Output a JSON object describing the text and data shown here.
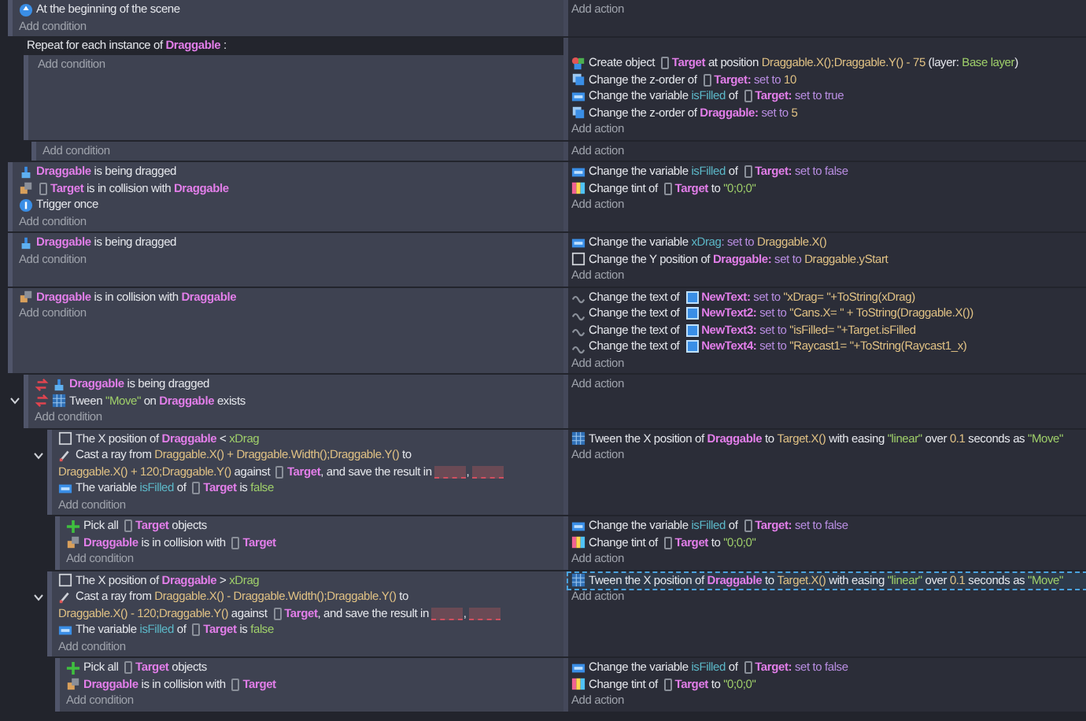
{
  "events": [
    {
      "conditions": [
        {
          "kind": "start",
          "inverted": false,
          "parts": [
            {
              "kind": "text",
              "text": "At the beginning of the scene"
            }
          ]
        }
      ],
      "add_condition": "Add condition",
      "add_action": "Add action"
    },
    {
      "header": [
        {
          "kind": "text",
          "text": "Repeat for each instance of "
        },
        {
          "kind": "object",
          "text": "Draggable"
        },
        {
          "kind": "text",
          "text": " :"
        }
      ],
      "add_condition": "Add condition",
      "actions": [
        {
          "kind": "create",
          "selected": false,
          "parts": [
            {
              "kind": "text",
              "text": "Create object "
            },
            {
              "kind": "object",
              "text": "Target",
              "thumbnail": true
            },
            {
              "kind": "text",
              "text": " at position "
            },
            {
              "kind": "expr",
              "text": "Draggable.X();Draggable.Y() - 75"
            },
            {
              "kind": "text",
              "text": " (layer: "
            },
            {
              "kind": "string",
              "text": "Base layer"
            },
            {
              "kind": "text",
              "text": ")"
            }
          ]
        },
        {
          "kind": "zorder",
          "selected": false,
          "parts": [
            {
              "kind": "text",
              "text": "Change the z-order of "
            },
            {
              "kind": "object",
              "text": "Target:",
              "thumbnail": true
            },
            {
              "kind": "op",
              "text": " set to "
            },
            {
              "kind": "expr",
              "text": "10"
            }
          ]
        },
        {
          "kind": "variable",
          "selected": false,
          "parts": [
            {
              "kind": "text",
              "text": "Change the variable "
            },
            {
              "kind": "var",
              "text": "isFilled"
            },
            {
              "kind": "text",
              "text": " of "
            },
            {
              "kind": "object",
              "text": "Target:",
              "thumbnail": true
            },
            {
              "kind": "op",
              "text": " set to true"
            }
          ]
        },
        {
          "kind": "zorder",
          "selected": false,
          "parts": [
            {
              "kind": "text",
              "text": "Change the z-order of "
            },
            {
              "kind": "object",
              "text": "Draggable:"
            },
            {
              "kind": "op",
              "text": " set to "
            },
            {
              "kind": "expr",
              "text": "5"
            }
          ]
        }
      ],
      "add_action": "Add action",
      "children": [
        {
          "add_condition": "Add condition",
          "add_action": "Add action"
        }
      ]
    },
    {
      "conditions": [
        {
          "kind": "drag",
          "inverted": false,
          "parts": [
            {
              "kind": "object",
              "text": "Draggable"
            },
            {
              "kind": "text",
              "text": " is being dragged"
            }
          ]
        },
        {
          "kind": "collision",
          "inverted": false,
          "parts": [
            {
              "kind": "object",
              "text": "Target",
              "thumbnail": true
            },
            {
              "kind": "text",
              "text": " is in collision with "
            },
            {
              "kind": "object",
              "text": "Draggable"
            }
          ]
        },
        {
          "kind": "once",
          "inverted": false,
          "parts": [
            {
              "kind": "text",
              "text": "Trigger once"
            }
          ]
        }
      ],
      "add_condition": "Add condition",
      "actions": [
        {
          "kind": "variable",
          "selected": false,
          "parts": [
            {
              "kind": "text",
              "text": "Change the variable "
            },
            {
              "kind": "var",
              "text": "isFilled"
            },
            {
              "kind": "text",
              "text": " of "
            },
            {
              "kind": "object",
              "text": "Target:",
              "thumbnail": true
            },
            {
              "kind": "op",
              "text": " set to false"
            }
          ]
        },
        {
          "kind": "tint",
          "selected": false,
          "parts": [
            {
              "kind": "text",
              "text": "Change tint of "
            },
            {
              "kind": "object",
              "text": "Target",
              "thumbnail": true
            },
            {
              "kind": "text",
              "text": " to "
            },
            {
              "kind": "string",
              "text": "\"0;0;0\""
            }
          ]
        }
      ],
      "add_action": "Add action"
    },
    {
      "conditions": [
        {
          "kind": "drag",
          "inverted": false,
          "parts": [
            {
              "kind": "object",
              "text": "Draggable"
            },
            {
              "kind": "text",
              "text": " is being dragged"
            }
          ]
        }
      ],
      "add_condition": "Add condition",
      "actions": [
        {
          "kind": "variable",
          "selected": false,
          "parts": [
            {
              "kind": "text",
              "text": "Change the variable "
            },
            {
              "kind": "var",
              "text": "xDrag"
            },
            {
              "kind": "op",
              "text": ": set to "
            },
            {
              "kind": "expr",
              "text": "Draggable.X()"
            }
          ]
        },
        {
          "kind": "position",
          "selected": false,
          "parts": [
            {
              "kind": "text",
              "text": "Change the Y position of "
            },
            {
              "kind": "object",
              "text": "Draggable:"
            },
            {
              "kind": "op",
              "text": " set to "
            },
            {
              "kind": "expr",
              "text": "Draggable.yStart"
            }
          ]
        }
      ],
      "add_action": "Add action"
    },
    {
      "conditions": [
        {
          "kind": "collision",
          "inverted": false,
          "parts": [
            {
              "kind": "object",
              "text": "Draggable"
            },
            {
              "kind": "text",
              "text": " is in collision with "
            },
            {
              "kind": "object",
              "text": "Draggable"
            }
          ]
        }
      ],
      "add_condition": "Add condition",
      "actions": [
        {
          "kind": "text",
          "selected": false,
          "parts": [
            {
              "kind": "text",
              "text": "Change the text of "
            },
            {
              "kind": "object",
              "text": "NewText:",
              "thumbnail": true
            },
            {
              "kind": "op",
              "text": " set to "
            },
            {
              "kind": "expr",
              "text": "\"xDrag= \"+ToString(xDrag)"
            }
          ]
        },
        {
          "kind": "text",
          "selected": false,
          "parts": [
            {
              "kind": "text",
              "text": "Change the text of "
            },
            {
              "kind": "object",
              "text": "NewText2:",
              "thumbnail": true
            },
            {
              "kind": "op",
              "text": " set to "
            },
            {
              "kind": "expr",
              "text": "\"Cans.X= \" + ToString(Draggable.X())"
            }
          ]
        },
        {
          "kind": "text",
          "selected": false,
          "parts": [
            {
              "kind": "text",
              "text": "Change the text of "
            },
            {
              "kind": "object",
              "text": "NewText3:",
              "thumbnail": true
            },
            {
              "kind": "op",
              "text": " set to "
            },
            {
              "kind": "expr",
              "text": "\"isFilled= \"+Target.isFilled"
            }
          ]
        },
        {
          "kind": "text",
          "selected": false,
          "parts": [
            {
              "kind": "text",
              "text": "Change the text of "
            },
            {
              "kind": "object",
              "text": "NewText4:",
              "thumbnail": true
            },
            {
              "kind": "op",
              "text": " set to "
            },
            {
              "kind": "expr",
              "text": "\"Raycast1= \"+ToString(Raycast1_x)"
            }
          ]
        }
      ],
      "add_action": "Add action"
    },
    {
      "expanded": true,
      "conditions": [
        {
          "kind": "drag",
          "inverted": true,
          "parts": [
            {
              "kind": "object",
              "text": "Draggable"
            },
            {
              "kind": "text",
              "text": " is being dragged"
            }
          ]
        },
        {
          "kind": "tween",
          "inverted": true,
          "parts": [
            {
              "kind": "text",
              "text": "Tween "
            },
            {
              "kind": "string",
              "text": "\"Move\""
            },
            {
              "kind": "text",
              "text": " on "
            },
            {
              "kind": "object",
              "text": "Draggable"
            },
            {
              "kind": "text",
              "text": " exists"
            }
          ]
        }
      ],
      "add_condition": "Add condition",
      "add_action": "Add action",
      "children": [
        {
          "expanded": true,
          "conditions": [
            {
              "kind": "position",
              "inverted": false,
              "parts": [
                {
                  "kind": "text",
                  "text": "The X position of "
                },
                {
                  "kind": "object",
                  "text": "Draggable"
                },
                {
                  "kind": "text",
                  "text": " < "
                },
                {
                  "kind": "string",
                  "text": "xDrag"
                }
              ]
            },
            {
              "kind": "raycast",
              "inverted": false,
              "parts": [
                {
                  "kind": "text",
                  "text": "Cast a ray from "
                },
                {
                  "kind": "expr",
                  "text": "Draggable.X() + Draggable.Width();Draggable.Y()"
                },
                {
                  "kind": "text",
                  "text": " to "
                },
                {
                  "kind": "expr",
                  "text": "Draggable.X() + 120;Draggable.Y()"
                },
                {
                  "kind": "text",
                  "text": " against "
                },
                {
                  "kind": "object",
                  "text": "Target",
                  "thumbnail": true
                },
                {
                  "kind": "text",
                  "text": ", and save the result in "
                },
                {
                  "kind": "blank"
                },
                {
                  "kind": "text",
                  "text": ", "
                },
                {
                  "kind": "blank"
                }
              ]
            },
            {
              "kind": "variable",
              "inverted": false,
              "parts": [
                {
                  "kind": "text",
                  "text": "The variable "
                },
                {
                  "kind": "var",
                  "text": "isFilled"
                },
                {
                  "kind": "text",
                  "text": " of "
                },
                {
                  "kind": "object",
                  "text": "Target",
                  "thumbnail": true
                },
                {
                  "kind": "text",
                  "text": " is "
                },
                {
                  "kind": "string",
                  "text": "false"
                }
              ]
            }
          ],
          "add_condition": "Add condition",
          "actions": [
            {
              "kind": "tween",
              "selected": false,
              "parts": [
                {
                  "kind": "text",
                  "text": "Tween the X position of "
                },
                {
                  "kind": "object",
                  "text": "Draggable"
                },
                {
                  "kind": "text",
                  "text": " to "
                },
                {
                  "kind": "expr",
                  "text": "Target.X()"
                },
                {
                  "kind": "text",
                  "text": " with easing "
                },
                {
                  "kind": "string",
                  "text": "\"linear\""
                },
                {
                  "kind": "text",
                  "text": " over "
                },
                {
                  "kind": "expr",
                  "text": "0.1"
                },
                {
                  "kind": "text",
                  "text": " seconds as "
                },
                {
                  "kind": "string",
                  "text": "\"Move\""
                }
              ]
            }
          ],
          "add_action": "Add action",
          "children": [
            {
              "conditions": [
                {
                  "kind": "pick",
                  "inverted": false,
                  "parts": [
                    {
                      "kind": "text",
                      "text": "Pick all "
                    },
                    {
                      "kind": "object",
                      "text": "Target",
                      "thumbnail": true
                    },
                    {
                      "kind": "text",
                      "text": " objects"
                    }
                  ]
                },
                {
                  "kind": "collision",
                  "inverted": false,
                  "parts": [
                    {
                      "kind": "object",
                      "text": "Draggable"
                    },
                    {
                      "kind": "text",
                      "text": " is in collision with "
                    },
                    {
                      "kind": "object",
                      "text": "Target",
                      "thumbnail": true
                    }
                  ]
                }
              ],
              "add_condition": "Add condition",
              "actions": [
                {
                  "kind": "variable",
                  "selected": false,
                  "parts": [
                    {
                      "kind": "text",
                      "text": "Change the variable "
                    },
                    {
                      "kind": "var",
                      "text": "isFilled"
                    },
                    {
                      "kind": "text",
                      "text": " of "
                    },
                    {
                      "kind": "object",
                      "text": "Target:",
                      "thumbnail": true
                    },
                    {
                      "kind": "op",
                      "text": " set to false"
                    }
                  ]
                },
                {
                  "kind": "tint",
                  "selected": false,
                  "parts": [
                    {
                      "kind": "text",
                      "text": "Change tint of "
                    },
                    {
                      "kind": "object",
                      "text": "Target",
                      "thumbnail": true
                    },
                    {
                      "kind": "text",
                      "text": " to "
                    },
                    {
                      "kind": "string",
                      "text": "\"0;0;0\""
                    }
                  ]
                }
              ],
              "add_action": "Add action"
            }
          ]
        },
        {
          "expanded": true,
          "conditions": [
            {
              "kind": "position",
              "inverted": false,
              "parts": [
                {
                  "kind": "text",
                  "text": "The X position of "
                },
                {
                  "kind": "object",
                  "text": "Draggable"
                },
                {
                  "kind": "text",
                  "text": " > "
                },
                {
                  "kind": "string",
                  "text": "xDrag"
                }
              ]
            },
            {
              "kind": "raycast",
              "inverted": false,
              "parts": [
                {
                  "kind": "text",
                  "text": "Cast a ray from "
                },
                {
                  "kind": "expr",
                  "text": "Draggable.X() - Draggable.Width();Draggable.Y()"
                },
                {
                  "kind": "text",
                  "text": " to "
                },
                {
                  "kind": "expr",
                  "text": "Draggable.X() - 120;Draggable.Y()"
                },
                {
                  "kind": "text",
                  "text": " against "
                },
                {
                  "kind": "object",
                  "text": "Target",
                  "thumbnail": true
                },
                {
                  "kind": "text",
                  "text": ", and save the result in "
                },
                {
                  "kind": "blank"
                },
                {
                  "kind": "text",
                  "text": ", "
                },
                {
                  "kind": "blank"
                }
              ]
            },
            {
              "kind": "variable",
              "inverted": false,
              "parts": [
                {
                  "kind": "text",
                  "text": "The variable "
                },
                {
                  "kind": "var",
                  "text": "isFilled"
                },
                {
                  "kind": "text",
                  "text": " of "
                },
                {
                  "kind": "object",
                  "text": "Target",
                  "thumbnail": true
                },
                {
                  "kind": "text",
                  "text": " is "
                },
                {
                  "kind": "string",
                  "text": "false"
                }
              ]
            }
          ],
          "add_condition": "Add condition",
          "actions": [
            {
              "kind": "tween",
              "selected": true,
              "parts": [
                {
                  "kind": "text",
                  "text": "Tween the X position of "
                },
                {
                  "kind": "object",
                  "text": "Draggable"
                },
                {
                  "kind": "text",
                  "text": " to "
                },
                {
                  "kind": "expr",
                  "text": "Target.X()"
                },
                {
                  "kind": "text",
                  "text": " with easing "
                },
                {
                  "kind": "string",
                  "text": "\"linear\""
                },
                {
                  "kind": "text",
                  "text": " over "
                },
                {
                  "kind": "expr",
                  "text": "0.1"
                },
                {
                  "kind": "text",
                  "text": " seconds as "
                },
                {
                  "kind": "string",
                  "text": "\"Move\""
                }
              ]
            }
          ],
          "add_action": "Add action",
          "children": [
            {
              "conditions": [
                {
                  "kind": "pick",
                  "inverted": false,
                  "parts": [
                    {
                      "kind": "text",
                      "text": "Pick all "
                    },
                    {
                      "kind": "object",
                      "text": "Target",
                      "thumbnail": true
                    },
                    {
                      "kind": "text",
                      "text": " objects"
                    }
                  ]
                },
                {
                  "kind": "collision",
                  "inverted": false,
                  "parts": [
                    {
                      "kind": "object",
                      "text": "Draggable"
                    },
                    {
                      "kind": "text",
                      "text": " is in collision with "
                    },
                    {
                      "kind": "object",
                      "text": "Target",
                      "thumbnail": true
                    }
                  ]
                }
              ],
              "add_condition": "Add condition",
              "actions": [
                {
                  "kind": "variable",
                  "selected": false,
                  "parts": [
                    {
                      "kind": "text",
                      "text": "Change the variable "
                    },
                    {
                      "kind": "var",
                      "text": "isFilled"
                    },
                    {
                      "kind": "text",
                      "text": " of "
                    },
                    {
                      "kind": "object",
                      "text": "Target:",
                      "thumbnail": true
                    },
                    {
                      "kind": "op",
                      "text": " set to false"
                    }
                  ]
                },
                {
                  "kind": "tint",
                  "selected": false,
                  "parts": [
                    {
                      "kind": "text",
                      "text": "Change tint of "
                    },
                    {
                      "kind": "object",
                      "text": "Target",
                      "thumbnail": true
                    },
                    {
                      "kind": "text",
                      "text": " to "
                    },
                    {
                      "kind": "string",
                      "text": "\"0;0;0\""
                    }
                  ]
                }
              ],
              "add_action": "Add action"
            }
          ]
        }
      ]
    }
  ]
}
